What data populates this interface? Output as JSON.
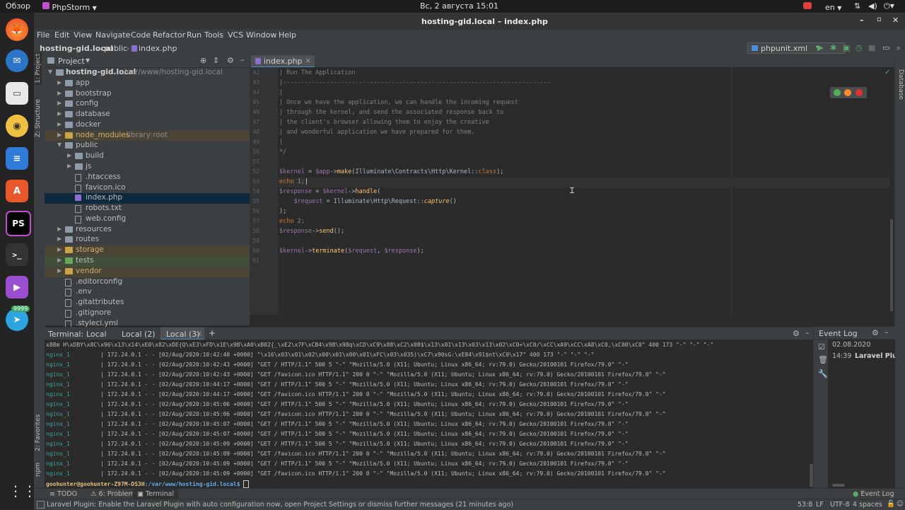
{
  "topbar": {
    "activities": "Обзор",
    "app_name": "PhpStorm",
    "clock": "Вс, 2 августа 15:01",
    "lang": "en"
  },
  "dock": {
    "telegram_badge": "9999"
  },
  "window": {
    "title": "hosting-gid.local – index.php"
  },
  "menu": [
    "File",
    "Edit",
    "View",
    "Navigate",
    "Code",
    "Refactor",
    "Run",
    "Tools",
    "VCS",
    "Window",
    "Help"
  ],
  "breadcrumb": {
    "project": "hosting-gid.local",
    "folder": "public",
    "file": "index.php"
  },
  "run_config": "phpunit.xml",
  "side_tabs": {
    "project": "1: Project",
    "structure": "Z: Structure",
    "favorites": "2: Favorites",
    "npm": "npm",
    "database": "Database"
  },
  "project_panel": {
    "title": "Project",
    "root_name": "hosting-gid.local",
    "root_path": "/var/www/hosting-gid.local",
    "items": [
      {
        "label": "app",
        "type": "folder",
        "depth": 1,
        "expanded": false
      },
      {
        "label": "bootstrap",
        "type": "folder",
        "depth": 1,
        "expanded": false
      },
      {
        "label": "config",
        "type": "folder",
        "depth": 1,
        "expanded": false
      },
      {
        "label": "database",
        "type": "folder",
        "depth": 1,
        "expanded": false
      },
      {
        "label": "docker",
        "type": "folder",
        "depth": 1,
        "expanded": false
      },
      {
        "label": "node_modules",
        "type": "folder",
        "depth": 1,
        "expanded": false,
        "note": "library root",
        "excluded": true
      },
      {
        "label": "public",
        "type": "folder",
        "depth": 1,
        "expanded": true
      },
      {
        "label": "build",
        "type": "folder",
        "depth": 2,
        "expanded": false
      },
      {
        "label": "js",
        "type": "folder",
        "depth": 2,
        "expanded": false
      },
      {
        "label": ".htaccess",
        "type": "file",
        "depth": 2
      },
      {
        "label": "favicon.ico",
        "type": "file",
        "depth": 2
      },
      {
        "label": "index.php",
        "type": "php",
        "depth": 2,
        "selected": true
      },
      {
        "label": "robots.txt",
        "type": "file",
        "depth": 2
      },
      {
        "label": "web.config",
        "type": "file",
        "depth": 2
      },
      {
        "label": "resources",
        "type": "folder",
        "depth": 1,
        "expanded": false
      },
      {
        "label": "routes",
        "type": "folder",
        "depth": 1,
        "expanded": false
      },
      {
        "label": "storage",
        "type": "folder",
        "depth": 1,
        "expanded": false,
        "excluded": true
      },
      {
        "label": "tests",
        "type": "folder",
        "depth": 1,
        "expanded": false,
        "tests": true
      },
      {
        "label": "vendor",
        "type": "folder",
        "depth": 1,
        "expanded": false,
        "excluded": true
      },
      {
        "label": ".editorconfig",
        "type": "file",
        "depth": 1
      },
      {
        "label": ".env",
        "type": "file",
        "depth": 1
      },
      {
        "label": ".gitattributes",
        "type": "file",
        "depth": 1
      },
      {
        "label": ".gitignore",
        "type": "file",
        "depth": 1
      },
      {
        "label": ".styleci.yml",
        "type": "file",
        "depth": 1
      }
    ]
  },
  "editor": {
    "tab": "index.php",
    "lines": [
      {
        "n": "42",
        "parts": [
          [
            "cmt",
            "| Run The Application"
          ]
        ]
      },
      {
        "n": "43",
        "parts": [
          [
            "cmt",
            "|--------------------------------------------------------------------------"
          ]
        ]
      },
      {
        "n": "44",
        "parts": [
          [
            "cmt",
            "|"
          ]
        ]
      },
      {
        "n": "45",
        "parts": [
          [
            "cmt",
            "| Once we have the application, we can handle the incoming request"
          ]
        ]
      },
      {
        "n": "46",
        "parts": [
          [
            "cmt",
            "| through the kernel, and send the associated response back to"
          ]
        ]
      },
      {
        "n": "47",
        "parts": [
          [
            "cmt",
            "| the client's browser allowing them to enjoy the creative"
          ]
        ]
      },
      {
        "n": "48",
        "parts": [
          [
            "cmt",
            "| and wonderful application we have prepared for them."
          ]
        ]
      },
      {
        "n": "49",
        "parts": [
          [
            "cmt",
            "|"
          ]
        ]
      },
      {
        "n": "50",
        "parts": [
          [
            "cmt",
            "*/"
          ]
        ]
      },
      {
        "n": "51",
        "parts": []
      },
      {
        "n": "52",
        "parts": [
          [
            "var",
            "$kernel"
          ],
          [
            "",
            " = "
          ],
          [
            "var",
            "$app"
          ],
          [
            "",
            "->"
          ],
          [
            "fn",
            "make"
          ],
          [
            "",
            "(Illuminate\\Contracts\\Http\\Kernel::"
          ],
          [
            "kw",
            "class"
          ],
          [
            "",
            ");"
          ]
        ]
      },
      {
        "n": "53",
        "parts": [
          [
            "kw",
            "echo "
          ],
          [
            "num",
            "1"
          ],
          [
            "kw",
            ";"
          ]
        ],
        "current": true
      },
      {
        "n": "54",
        "parts": [
          [
            "var",
            "$response"
          ],
          [
            "",
            " = "
          ],
          [
            "var",
            "$kernel"
          ],
          [
            "",
            "->"
          ],
          [
            "fn",
            "handle"
          ],
          [
            "",
            "("
          ]
        ]
      },
      {
        "n": "55",
        "parts": [
          [
            "",
            "    "
          ],
          [
            "var",
            "$request"
          ],
          [
            "",
            " = Illuminate\\Http\\Request::"
          ],
          [
            "it",
            "capture"
          ],
          [
            "",
            "()"
          ]
        ]
      },
      {
        "n": "56",
        "parts": [
          [
            "",
            ");"
          ]
        ]
      },
      {
        "n": "57",
        "parts": [
          [
            "kw",
            "echo "
          ],
          [
            "num",
            "2"
          ],
          [
            "kw",
            ";"
          ]
        ]
      },
      {
        "n": "58",
        "parts": [
          [
            "var",
            "$response"
          ],
          [
            "",
            "->"
          ],
          [
            "fn",
            "send"
          ],
          [
            "",
            "();"
          ]
        ]
      },
      {
        "n": "59",
        "parts": []
      },
      {
        "n": "60",
        "parts": [
          [
            "var",
            "$kernel"
          ],
          [
            "",
            "->"
          ],
          [
            "fn",
            "terminate"
          ],
          [
            "",
            "("
          ],
          [
            "var",
            "$request"
          ],
          [
            "",
            ", "
          ],
          [
            "var",
            "$response"
          ],
          [
            "",
            ");"
          ]
        ]
      },
      {
        "n": "61",
        "parts": []
      }
    ]
  },
  "terminal": {
    "title": "Terminal:",
    "tabs": [
      "Local",
      "Local (2)",
      "Local (3)"
    ],
    "first_line": "x88m H\\xDBY\\x8C\\x96\\x13\\x14\\xE0\\x82\\xDE{Q\\xE3\\xFD\\x1E\\x9B\\xA0\\xB02{_\\xE2\\x7F\\xCB4\\x98\\x98q\\xCD\\xC9\\x88\\xC2\\x08$\\x13\\x01\\x13\\x03\\x13\\x02\\xC0+\\xC0/\\xCC\\xA9\\xCC\\xA8\\xC0,\\xC00\\xC0\" 400 173 \"-\" \"-\" \"-\"",
    "lines": [
      {
        "svc": "nginx_1",
        "text": "| 172.24.0.1 - - [02/Aug/2020:10:42:40 +0000] \"\\x16\\x03\\x01\\x02\\x00\\x01\\x00\\x01\\xFC\\x03\\x035)\\xC7\\x90sG:\\xE84\\x91$nt\\xC0\\x17\" 400 173 \"-\" \"-\" \"-\""
      },
      {
        "svc": "nginx_1",
        "text": "| 172.24.0.1 - - [02/Aug/2020:10:42:43 +0000] \"GET / HTTP/1.1\" 500 5 \"-\" \"Mozilla/5.0 (X11; Ubuntu; Linux x86_64; rv:79.0) Gecko/20100101 Firefox/79.0\" \"-\""
      },
      {
        "svc": "nginx_1",
        "text": "| 172.24.0.1 - - [02/Aug/2020:10:42:43 +0000] \"GET /favicon.ico HTTP/1.1\" 200 0 \"-\" \"Mozilla/5.0 (X11; Ubuntu; Linux x86_64; rv:79.0) Gecko/20100101 Firefox/79.0\" \"-\""
      },
      {
        "svc": "nginx_1",
        "text": "| 172.24.0.1 - - [02/Aug/2020:10:44:17 +0000] \"GET / HTTP/1.1\" 500 5 \"-\" \"Mozilla/5.0 (X11; Ubuntu; Linux x86_64; rv:79.0) Gecko/20100101 Firefox/79.0\" \"-\""
      },
      {
        "svc": "nginx_1",
        "text": "| 172.24.0.1 - - [02/Aug/2020:10:44:17 +0000] \"GET /favicon.ico HTTP/1.1\" 200 0 \"-\" \"Mozilla/5.0 (X11; Ubuntu; Linux x86_64; rv:79.0) Gecko/20100101 Firefox/79.0\" \"-\""
      },
      {
        "svc": "nginx_1",
        "text": "| 172.24.0.1 - - [02/Aug/2020:10:45:06 +0000] \"GET / HTTP/1.1\" 500 5 \"-\" \"Mozilla/5.0 (X11; Ubuntu; Linux x86_64; rv:79.0) Gecko/20100101 Firefox/79.0\" \"-\""
      },
      {
        "svc": "nginx_1",
        "text": "| 172.24.0.1 - - [02/Aug/2020:10:45:06 +0000] \"GET /favicon.ico HTTP/1.1\" 200 0 \"-\" \"Mozilla/5.0 (X11; Ubuntu; Linux x86_64; rv:79.0) Gecko/20100101 Firefox/79.0\" \"-\""
      },
      {
        "svc": "nginx_1",
        "text": "| 172.24.0.1 - - [02/Aug/2020:10:45:07 +0000] \"GET / HTTP/1.1\" 500 5 \"-\" \"Mozilla/5.0 (X11; Ubuntu; Linux x86_64; rv:79.0) Gecko/20100101 Firefox/79.0\" \"-\""
      },
      {
        "svc": "nginx_1",
        "text": "| 172.24.0.1 - - [02/Aug/2020:10:45:07 +0000] \"GET / HTTP/1.1\" 500 5 \"-\" \"Mozilla/5.0 (X11; Ubuntu; Linux x86_64; rv:79.0) Gecko/20100101 Firefox/79.0\" \"-\""
      },
      {
        "svc": "nginx_1",
        "text": "| 172.24.0.1 - - [02/Aug/2020:10:45:09 +0000] \"GET / HTTP/1.1\" 500 5 \"-\" \"Mozilla/5.0 (X11; Ubuntu; Linux x86_64; rv:79.0) Gecko/20100101 Firefox/79.0\" \"-\""
      },
      {
        "svc": "nginx_1",
        "text": "| 172.24.0.1 - - [02/Aug/2020:10:45:09 +0000] \"GET /favicon.ico HTTP/1.1\" 200 0 \"-\" \"Mozilla/5.0 (X11; Ubuntu; Linux x86_64; rv:79.0) Gecko/20100101 Firefox/79.0\" \"-\""
      },
      {
        "svc": "nginx_1",
        "text": "| 172.24.0.1 - - [02/Aug/2020:10:45:09 +0000] \"GET / HTTP/1.1\" 500 5 \"-\" \"Mozilla/5.0 (X11; Ubuntu; Linux x86_64; rv:79.0) Gecko/20100101 Firefox/79.0\" \"-\""
      },
      {
        "svc": "nginx_1",
        "text": "| 172.24.0.1 - - [02/Aug/2020:10:45:09 +0000] \"GET /favicon.ico HTTP/1.1\" 200 0 \"-\" \"Mozilla/5.0 (X11; Ubuntu; Linux x86_64; rv:79.0) Gecko/20100101 Firefox/79.0\" \"-\""
      }
    ],
    "prompt_user": "goohunter@goohunter-Z97M-DS3H",
    "prompt_path": ":/var/www/hosting-gid.local$"
  },
  "event_log": {
    "title": "Event Log",
    "date": "02.08.2020",
    "time": "14:39",
    "message": "Laravel Plugin"
  },
  "bottom_tabs": {
    "todo": "TODO",
    "problems": "6: Problems",
    "terminal": "Terminal",
    "event_log": "Event Log"
  },
  "status": {
    "message": "Laravel Plugin: Enable the Laravel Plugin with auto configuration now, open Project Settings or dismiss further messages (21 minutes ago)",
    "position": "53:8",
    "line_sep": "LF",
    "encoding": "UTF-8",
    "indent": "4 spaces"
  },
  "colors": {
    "accent": "#4a88c7",
    "folder": "#8f9ba8",
    "excluded": "#8a7a4a",
    "tests_bg": "#3f4f3a"
  }
}
